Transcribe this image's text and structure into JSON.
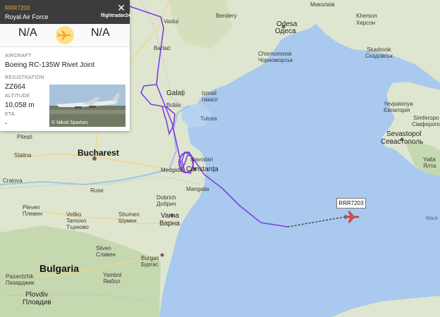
{
  "flight": {
    "callsign": "RRR7203",
    "operator": "Royal Air Force",
    "brand": "flightradar24",
    "origin": "N/A",
    "destination": "N/A",
    "aircraft_label": "AIRCRAFT",
    "aircraft": "Boeing RC-135W Rivet Joint",
    "registration_label": "REGISTRATION",
    "registration": "ZZ664",
    "altitude_label": "ALTITUDE",
    "altitude": "10,058 m",
    "eta_label": "ETA",
    "eta": "-",
    "photo_credit": "© Nikoli Sparkes"
  },
  "map": {
    "track_color": "#7b3fe4",
    "aircraft_color": "#e74c3c",
    "tag": "RRR7203",
    "labels": {
      "mykolaiv": "Миколаїв",
      "bendery": "Bendery",
      "odesa": "Odesa",
      "odesa_cy": "Одеса",
      "kherson": "Kherson",
      "kherson_cy": "Херсон",
      "chornomorsk": "Chornomorsk",
      "chornomorsk_cy": "Чорноморськ",
      "skadovsk": "Skadovsk",
      "skadovsk_cy": "Скадовськ",
      "vaslui": "Vaslui",
      "barlad": "Barlad",
      "galati": "Galați",
      "braila": "Brăila",
      "izmail": "Izmail",
      "izmail_cy": "Ізмаїл",
      "tulcea": "Tulcea",
      "yevpatoriya": "Yevpatoriya",
      "yevpatoriya_cy": "Євпаторія",
      "simferopol": "Simferopo",
      "simferopol_cy": "Сімферопо",
      "sevastopol": "Sevastopol",
      "sevastopol_cy": "Севастополь",
      "yalta": "Yalta",
      "yalta_cy": "Ялта",
      "bucharest": "Bucharest",
      "slatina": "Slatina",
      "pitesti": "Pitești",
      "navodari": "Navodari",
      "constanta": "Constanța",
      "medgidia": "Medgidia",
      "mangalia": "Mangalia",
      "dobrich": "Dobrich",
      "dobrich_cy": "Добрич",
      "ruse": "Ruse",
      "pleven": "Pleven",
      "pleven_cy": "Плевен",
      "veliko": "Veliko",
      "tarnovo": "Tarnovo",
      "tarnovo_cy": "Търново",
      "shumen": "Shumen",
      "shumen_cy": "Шумен",
      "varna": "Varna",
      "varna_cy": "Варна",
      "sliven": "Sliven",
      "sliven_cy": "Сливен",
      "bulgaria": "Bulgaria",
      "yambol": "Yambol",
      "yambol_cy": "Ямбол",
      "burgas": "Burgas",
      "burgas_cy": "Бургас",
      "pazardzhik": "Pazardzhik",
      "pazardzhik_cy": "Пазарджик",
      "plovdiv": "Plovdiv",
      "plovdiv_cy": "Пловдив",
      "craiova": "Craiova",
      "black_sea": "Black"
    }
  }
}
